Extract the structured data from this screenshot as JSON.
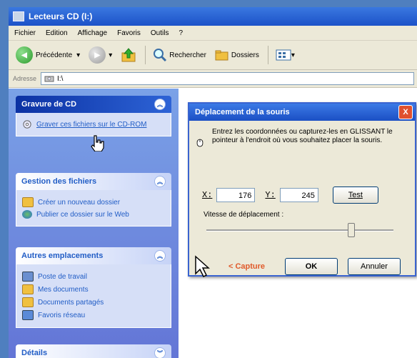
{
  "window": {
    "title": "Lecteurs CD (I:)",
    "menu": [
      "Fichier",
      "Edition",
      "Affichage",
      "Favoris",
      "Outils",
      "?"
    ],
    "toolbar": {
      "back": "Précédente",
      "search": "Rechercher",
      "folders": "Dossiers"
    },
    "address": {
      "label": "Adresse",
      "value": "I:\\"
    }
  },
  "sidebar": {
    "panels": [
      {
        "title": "Gravure de CD",
        "items": [
          "Graver ces fichiers sur le CD-ROM"
        ]
      },
      {
        "title": "Gestion des fichiers",
        "items": [
          "Créer un nouveau dossier",
          "Publier ce dossier sur le Web"
        ]
      },
      {
        "title": "Autres emplacements",
        "items": [
          "Poste de travail",
          "Mes documents",
          "Documents partagés",
          "Favoris réseau"
        ]
      },
      {
        "title": "Détails",
        "items": []
      }
    ]
  },
  "dialog": {
    "title": "Déplacement de la souris",
    "close": "X",
    "info": "Entrez les coordonnées ou capturez-les en GLISSANT le pointeur à l'endroit où vous souhaitez placer la souris.",
    "x_label": "X:",
    "x_value": "176",
    "y_label": "Y:",
    "y_value": "245",
    "test_button": "Test",
    "speed_label": "Vitesse de déplacement :",
    "speed_level": 0.78,
    "capture": "< Capture",
    "ok": "OK",
    "cancel": "Annuler"
  },
  "colors": {
    "accent": "#215dc6",
    "capture": "#e05a2a"
  }
}
